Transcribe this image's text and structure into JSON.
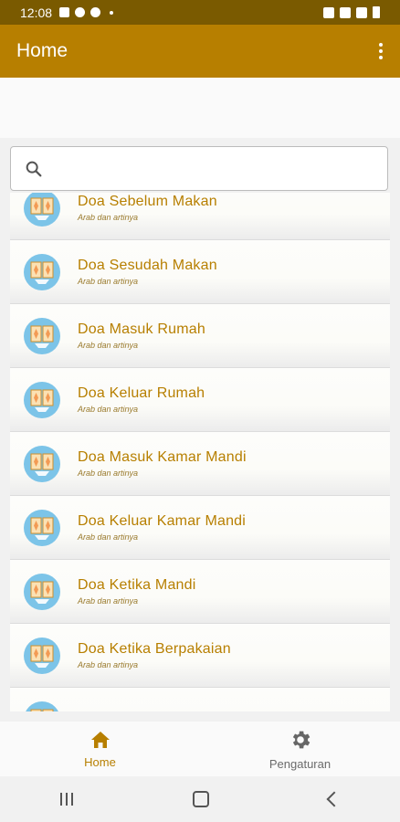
{
  "status_bar": {
    "time": "12:08"
  },
  "app_bar": {
    "title": "Home"
  },
  "search": {
    "placeholder": ""
  },
  "list": {
    "items": [
      {
        "title": "Doa Sebelum Makan",
        "subtitle": "Arab dan artinya"
      },
      {
        "title": "Doa Sesudah Makan",
        "subtitle": "Arab dan artinya"
      },
      {
        "title": "Doa Masuk Rumah",
        "subtitle": "Arab dan artinya"
      },
      {
        "title": "Doa Keluar Rumah",
        "subtitle": "Arab dan artinya"
      },
      {
        "title": "Doa Masuk Kamar Mandi",
        "subtitle": "Arab dan artinya"
      },
      {
        "title": "Doa Keluar Kamar Mandi",
        "subtitle": "Arab dan artinya"
      },
      {
        "title": "Doa Ketika Mandi",
        "subtitle": "Arab dan artinya"
      },
      {
        "title": "Doa Ketika Berpakaian",
        "subtitle": "Arab dan artinya"
      },
      {
        "title": "",
        "subtitle": ""
      }
    ]
  },
  "bottom_nav": {
    "home_label": "Home",
    "settings_label": "Pengaturan"
  },
  "colors": {
    "primary": "#b77f00",
    "status_bar": "#7a5a00",
    "icon_blue": "#7cc4e8",
    "icon_orange": "#f39b55"
  },
  "icons": {
    "list_item": "quran-book-icon",
    "home": "home-icon",
    "settings": "gear-icon",
    "search": "search-icon"
  }
}
